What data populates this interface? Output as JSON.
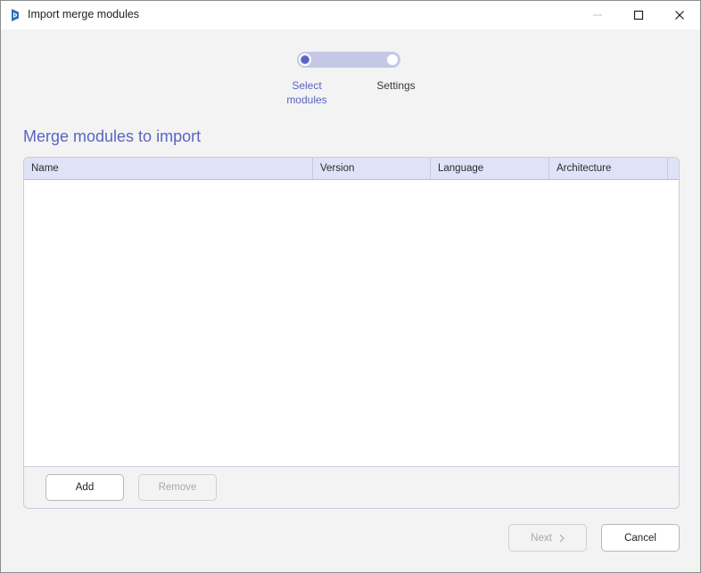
{
  "window": {
    "title": "Import merge modules",
    "icon": "app-logo-icon"
  },
  "stepper": {
    "steps": [
      {
        "label": "Select\nmodules",
        "state": "active"
      },
      {
        "label": "Settings",
        "state": "inactive"
      }
    ]
  },
  "section_title": "Merge modules to import",
  "table": {
    "columns": [
      "Name",
      "Version",
      "Language",
      "Architecture"
    ],
    "rows": []
  },
  "table_actions": {
    "add_label": "Add",
    "remove_label": "Remove"
  },
  "footer": {
    "next_label": "Next",
    "cancel_label": "Cancel"
  },
  "colors": {
    "accent": "#5a63c4",
    "header_bg": "#e0e3f8",
    "track": "#c4c8e6"
  }
}
